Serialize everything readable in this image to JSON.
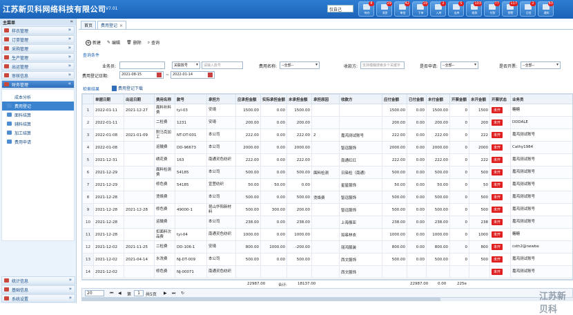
{
  "app": {
    "company": "江苏新贝科网络科技有限公司",
    "version": "V7.01",
    "org_select": "仅自己"
  },
  "toolbar_icons": [
    {
      "label": "待办",
      "badge": "8"
    },
    {
      "label": "消息",
      "badge": "29"
    },
    {
      "label": "审批",
      "badge": "42"
    },
    {
      "label": "下单",
      "badge": "19"
    },
    {
      "label": "入库",
      "badge": "2"
    },
    {
      "label": "出库",
      "badge": "5"
    },
    {
      "label": "收款",
      "badge": "103"
    },
    {
      "label": "付款",
      "badge": "77"
    },
    {
      "label": "预警",
      "badge": "117"
    },
    {
      "label": "日程",
      "badge": "2"
    },
    {
      "label": "通知",
      "badge": "63"
    }
  ],
  "sidebar": {
    "title": "主菜单",
    "collapse": "«",
    "menus": [
      {
        "label": "样衣管理"
      },
      {
        "label": "订单管理"
      },
      {
        "label": "采购管理"
      },
      {
        "label": "生产管理"
      },
      {
        "label": "出运管理"
      },
      {
        "label": "审核信息"
      },
      {
        "label": "财务管理"
      }
    ],
    "submenu": [
      {
        "label": "成本分析"
      },
      {
        "label": "费用登记"
      },
      {
        "label": "面料结算"
      },
      {
        "label": "辅料结算"
      },
      {
        "label": "加工结算"
      },
      {
        "label": "费用申请"
      }
    ],
    "bottom_menus": [
      {
        "label": "统计信息"
      },
      {
        "label": "基础信息"
      },
      {
        "label": "系统设置"
      }
    ]
  },
  "tabs": [
    {
      "label": "首页"
    },
    {
      "label": "费用登记",
      "close": "×"
    }
  ],
  "actions": {
    "new": "新建",
    "edit": "编辑",
    "delete": "删除",
    "query": "查询"
  },
  "query": {
    "title": "查询条件",
    "salesman_label": "业务员:",
    "keyword_select": "关联款号",
    "keyword_placeholder": "请输入款号",
    "fee_name_label": "费用名称:",
    "fee_name_value": "--全部--",
    "payee_label": "收款方:",
    "payee_placeholder": "支持模糊搜索多个关键字",
    "invoice_apply_label": "是否申请:",
    "invoice_apply_value": "--全部--",
    "invoice_open_label": "是否开票:",
    "invoice_open_value": "--全部--",
    "date_label": "费用登记日期:",
    "date_from": "2021-08-15",
    "date_sep": "~",
    "date_to": "2022-01-14"
  },
  "results": {
    "title": "检索结果",
    "download": "费用登记下载"
  },
  "table": {
    "headers": [
      "",
      "单据日期",
      "出运日期",
      "费用名称",
      "款号",
      "承担方",
      "应承担金额",
      "实际承担金额",
      "未承担金额",
      "承担原因",
      "收款方",
      "应付金额",
      "已付金额",
      "未付金额",
      "开票金额",
      "未开金额",
      "开票状态",
      "业务员"
    ],
    "rows": [
      [
        "1",
        "2022-01-11",
        "2021-12-27",
        "面料补料费",
        "tyl-03",
        "安琦",
        "1500.00",
        "0.00",
        "1500.00",
        "",
        "",
        "1500.00",
        "0.00",
        "1500.00",
        "0",
        "1500",
        "未开",
        "糖糖"
      ],
      [
        "2",
        "2022-01-11",
        "",
        "二检费",
        "1231",
        "安琦",
        "200.00",
        "0.00",
        "200.00",
        "",
        "",
        "200.00",
        "0.00",
        "200.00",
        "0",
        "200",
        "未开",
        "DDDALE"
      ],
      [
        "3",
        "2022-01-08",
        "2021-01-09",
        "附马克加工",
        "NT-DT-001",
        "本公司",
        "222.00",
        "0.00",
        "222.00",
        "2",
        "嘉鸿测试账号",
        "222.00",
        "0.00",
        "222.00",
        "0",
        "222",
        "未开",
        "嘉鸿测试账号"
      ],
      [
        "4",
        "2022-01-08",
        "",
        "运输费",
        "DD-96673",
        "本公司",
        "2000.00",
        "0.00",
        "2000.00",
        "",
        "智远服饰",
        "2000.00",
        "0.00",
        "2000.00",
        "0",
        "2000",
        "未开",
        "Cathy1984"
      ],
      [
        "5",
        "2021-12-31",
        "",
        "绣花费",
        "163",
        "南通灵色纺织",
        "222.00",
        "0.00",
        "222.00",
        "",
        "南通红红",
        "222.00",
        "0.00",
        "222.00",
        "0",
        "222",
        "未开",
        "嘉鸿测试账号"
      ],
      [
        "6",
        "2021-12-29",
        "",
        "面料检测费",
        "54185",
        "本公司",
        "500.00",
        "0.00",
        "500.00",
        "面料检测",
        "日染检（南通）",
        "500.00",
        "0.00",
        "500.00",
        "0",
        "500",
        "未开",
        "嘉鸿测试账号"
      ],
      [
        "7",
        "2021-12-29",
        "",
        "修色费",
        "54185",
        "宜萱纺织",
        "50.00",
        "50.00",
        "0.00",
        "",
        "星星服饰",
        "50.00",
        "0.00",
        "50.00",
        "0",
        "50",
        "未开",
        "嘉鸿测试账号"
      ],
      [
        "8",
        "2021-12-28",
        "",
        "烫烙费",
        "",
        "本公司",
        "500.00",
        "0.00",
        "500.00",
        "烫烙费",
        "智远服饰",
        "500.00",
        "0.00",
        "500.00",
        "0",
        "500",
        "未开",
        "嘉鸿测试账号"
      ],
      [
        "9",
        "2021-12-28",
        "2021-12-28",
        "修色费",
        "49000-1",
        "昆山华阳新材料",
        "500.00",
        "300.00",
        "200.00",
        "",
        "智远服饰",
        "500.00",
        "0.00",
        "500.00",
        "0",
        "500",
        "未开",
        "嘉鸿测试账号"
      ],
      [
        "10",
        "2021-12-28",
        "",
        "运输费",
        "",
        "本公司",
        "238.00",
        "0.00",
        "238.00",
        "",
        "上海振亚",
        "238.00",
        "0.00",
        "238.00",
        "0",
        "238",
        "未开",
        "嘉鸿测试账号"
      ],
      [
        "11",
        "2021-12-28",
        "",
        "扣面料次品费",
        "tyl-04",
        "南通灵色纺织",
        "1000.00",
        "0.00",
        "1000.00",
        "",
        "如皋林衣",
        "1000.00",
        "0.00",
        "1000.00",
        "0",
        "1000",
        "未开",
        "糖糖"
      ],
      [
        "12",
        "2021-12-02",
        "2021-11-25",
        "二检费",
        "DD-106-1",
        "安琦",
        "800.00",
        "1000.00",
        "-200.00",
        "",
        "丽鸿服装",
        "800.00",
        "0.00",
        "800.00",
        "0",
        "800",
        "未开",
        "csth2@newbe"
      ],
      [
        "13",
        "2021-12-02",
        "2021-04-14",
        "水洗费",
        "NJ-DT-009",
        "本公司",
        "500.00",
        "0.00",
        "500.00",
        "",
        "西文服饰",
        "500.00",
        "0.00",
        "500.00",
        "0",
        "500",
        "未开",
        "嘉鸿测试账号"
      ],
      [
        "14",
        "2021-12-02",
        "",
        "修色费",
        "NJ-00071",
        "南通灵色纺织",
        "",
        "",
        "",
        "",
        "西文服饰",
        "",
        "",
        "",
        "",
        "",
        "未开",
        "嘉鸿测试账号"
      ]
    ]
  },
  "summary": {
    "should": "22987.00",
    "actual_label": "合计:",
    "unpaid": "18137.00",
    "payable": "22987.00",
    "paid": "0.00",
    "rest": "225e"
  },
  "pager": {
    "page_size": "20",
    "page_label": "第",
    "page": "1",
    "total": "共5页",
    "first": "⏮",
    "prev": "◀",
    "next": "▶",
    "last": "⏭",
    "refresh": "↻"
  },
  "watermark": "江苏新贝科",
  "colors": {
    "header_blue": "#1a63b8",
    "status_red": "#e02020",
    "sidebar_bg": "#eaf2fb"
  }
}
